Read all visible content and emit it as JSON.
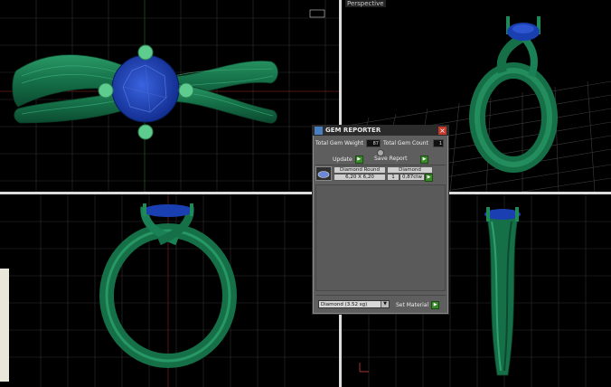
{
  "viewports": {
    "perspective_label": "Perspective"
  },
  "gem_reporter": {
    "title": "GEM REPORTER",
    "close_glyph": "×",
    "total_gem_weight_label": "Total Gem Weight",
    "total_gem_weight_value": "87",
    "total_gem_count_label": "Total Gem Count",
    "total_gem_count_value": "1",
    "update_label": "Update",
    "save_report_label": "Save Report",
    "go_glyph": "▶",
    "gem": {
      "cut_header": "Diamond Round",
      "material_header": "Diamond",
      "size": "6,20 X 6,20",
      "count": "1",
      "weight": "0,87ctw"
    },
    "material_select_value": "Diamond   (3.52 sg)",
    "set_material_label": "Set Material"
  },
  "colors": {
    "metal": "#1f7a4f",
    "gem": "#1a3fb0",
    "handle": "#5ecc8e",
    "grid": "#3a3a3a"
  }
}
